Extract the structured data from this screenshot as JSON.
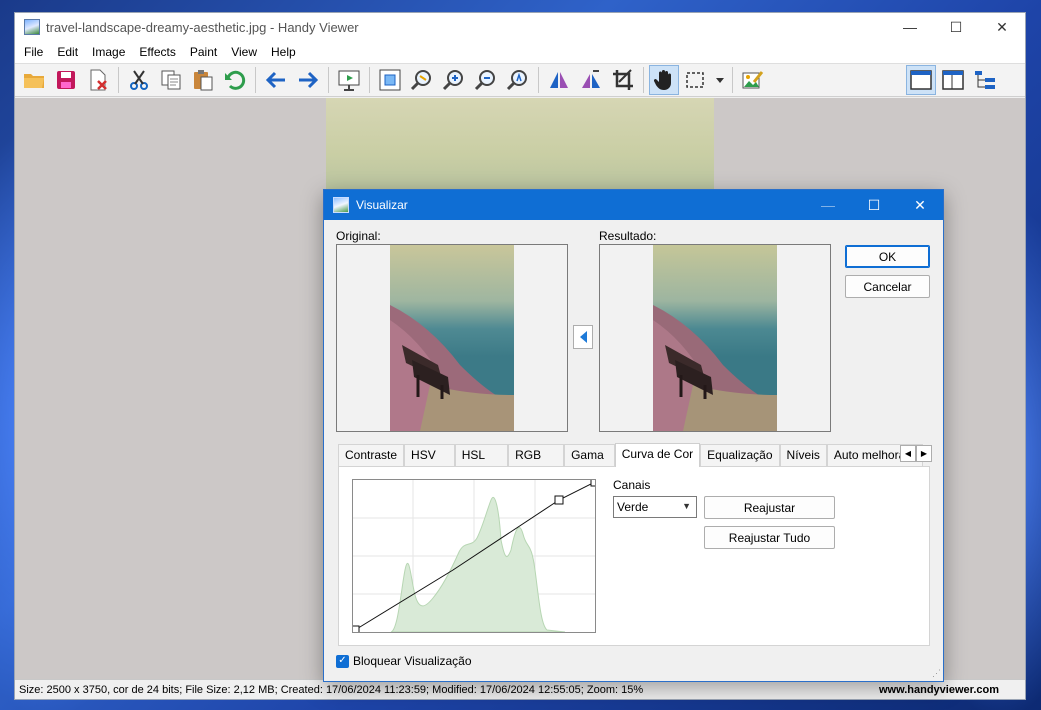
{
  "window": {
    "title": "travel-landscape-dreamy-aesthetic.jpg - Handy Viewer",
    "controls": {
      "minimize": "—",
      "maximize": "☐",
      "close": "✕"
    }
  },
  "menu": [
    "File",
    "Edit",
    "Image",
    "Effects",
    "Paint",
    "View",
    "Help"
  ],
  "toolbar": {
    "buttons": [
      "open-folder",
      "save",
      "delete-file",
      "cut",
      "copy",
      "paste",
      "undo",
      "previous",
      "next",
      "slideshow",
      "fit-to-window",
      "zoom-custom",
      "zoom-in",
      "zoom-out",
      "zoom-actual",
      "flip-horizontal",
      "flip-vertical",
      "crop",
      "hand-tool",
      "rectangle-select",
      "edit-image"
    ],
    "right_buttons": [
      "single-view",
      "dual-view",
      "tree-view"
    ]
  },
  "status": {
    "info": "Size: 2500 x 3750, cor de 24 bits; File Size: 2,12 MB; Created: 17/06/2024 11:23:59; Modified: 17/06/2024 12:55:05; Zoom: 15%",
    "url": "www.handyviewer.com"
  },
  "dialog": {
    "title": "Visualizar",
    "controls": {
      "minimize": "—",
      "maximize": "☐",
      "close": "✕"
    },
    "original_label": "Original:",
    "result_label": "Resultado:",
    "ok": "OK",
    "cancel": "Cancelar",
    "tabs": [
      "Contraste",
      "HSV",
      "HSL",
      "RGB",
      "Gama",
      "Curva de Cor",
      "Equalização",
      "Níveis",
      "Auto melhoramento"
    ],
    "active_tab": "Curva de Cor",
    "channels_label": "Canais",
    "channel_selected": "Verde",
    "reset": "Reajustar",
    "reset_all": "Reajustar Tudo",
    "lock_preview": "Bloquear Visualização",
    "lock_preview_checked": true
  },
  "colors": {
    "accent": "#0f6ed4",
    "histogram_fill": "#d9ead7",
    "histogram_stroke": "#b7d6b3"
  }
}
